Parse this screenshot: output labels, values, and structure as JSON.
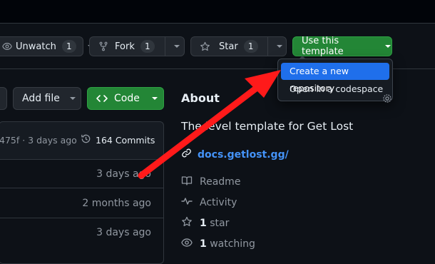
{
  "header": {
    "unwatch": {
      "label": "Unwatch",
      "count": "1"
    },
    "fork": {
      "label": "Fork",
      "count": "1"
    },
    "star": {
      "label": "Star",
      "count": "1"
    },
    "template_button": "Use this template"
  },
  "template_menu": {
    "items": [
      {
        "label": "Create a new repository",
        "highlighted": true
      },
      {
        "label": "Open in a codespace",
        "highlighted": false
      }
    ]
  },
  "toolbar": {
    "add_file": "Add file",
    "code": "Code"
  },
  "commits": {
    "latest": "475f · 3 days ago",
    "count_label": "164 Commits",
    "rows": [
      {
        "time": "3 days ago"
      },
      {
        "time": "2 months ago"
      },
      {
        "time": "3 days ago"
      }
    ]
  },
  "about": {
    "title": "About",
    "description": "The level template for Get Lost",
    "website": "docs.getlost.gg/",
    "items": [
      {
        "icon": "book-icon",
        "label": "Readme",
        "bold": ""
      },
      {
        "icon": "pulse-icon",
        "label": "Activity",
        "bold": ""
      },
      {
        "icon": "star-icon",
        "label": "star",
        "bold": "1"
      },
      {
        "icon": "eye-icon",
        "label": "watching",
        "bold": "1"
      }
    ]
  },
  "annotation": {
    "type": "arrow",
    "color": "#ff1a1a",
    "points_to": "Create a new repository"
  },
  "colors": {
    "background": "#0d1117",
    "button": "#21262d",
    "primary_green": "#238636",
    "highlight_blue": "#1f6feb",
    "link": "#4493f8"
  }
}
